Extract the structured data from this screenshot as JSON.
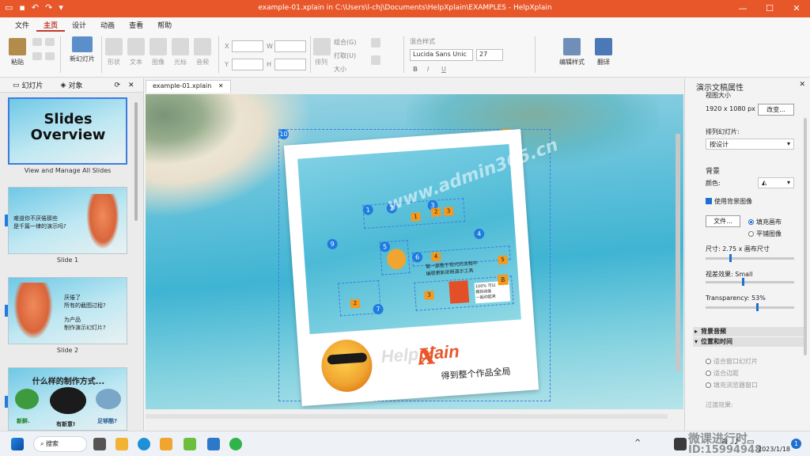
{
  "window": {
    "title": "example-01.xplain in C:\\Users\\l-chj\\Documents\\HelpXplain\\EXAMPLES - HelpXplain",
    "minimize": "—",
    "maximize": "☐",
    "close": "✕"
  },
  "menu": [
    "文件",
    "主页",
    "设计",
    "动画",
    "查看",
    "帮助"
  ],
  "ribbon": {
    "paste": "粘贴",
    "new_slide": "新幻灯片",
    "shape": "形状",
    "text": "文本",
    "image": "图像",
    "cursor": "光标",
    "audio": "音频",
    "x_label": "X",
    "y_label": "Y",
    "w_label": "W",
    "h_label": "H",
    "arrange": "排列",
    "group": "组合(G)",
    "ungroup": "打取(U)",
    "size": "大小",
    "mixed_style": "混合样式",
    "font_name": "Lucida Sans Unic",
    "font_size": "27",
    "bold": "B",
    "italic": "I",
    "underline": "U",
    "edit_style": "编辑样式",
    "translate": "翻译"
  },
  "left_panel": {
    "tab_slides": "幻灯片",
    "tab_objects": "对象",
    "slides": [
      {
        "num": "",
        "caption": "View and Manage All Slides",
        "title": "Slides Overview"
      },
      {
        "num": "1",
        "caption": "Slide 1",
        "text": "难道你不厌倦那些\n是千篇一律的演示吗?"
      },
      {
        "num": "2",
        "caption": "Slide 2",
        "text": "厌倦了\n所有的截图过程?\n\n为产品\n制作演示幻灯片?"
      },
      {
        "num": "3",
        "caption": "",
        "title": "什么样的制作方式...",
        "sub1": "新鲜.",
        "sub2": "有新意!",
        "sub3": "足够酷?"
      }
    ]
  },
  "canvas": {
    "doc_tab": "example-01.xplain",
    "watermark": "www.admin365.cn",
    "brand_help": "Help",
    "brand_x": "X",
    "brand_plain": "plain",
    "tagline": "得到整个作品全局",
    "badges": [
      "10",
      "1",
      "2",
      "3",
      "4",
      "5",
      "6",
      "7",
      "8",
      "9"
    ],
    "orange_labels": [
      "1",
      "1",
      "2",
      "3",
      "4",
      "5",
      "6",
      "2",
      "3"
    ],
    "note_1": "第一部整于现代的流程中\n编程更新说明演示工具",
    "note_2": "100% 可以\n模拟动画\n一起动起来"
  },
  "right_panel": {
    "title": "演示文稿属性",
    "view_size_label": "视图大小",
    "view_size": "1920 x 1080 px",
    "change_btn": "改变...",
    "arrange_label": "排列幻灯片:",
    "arrange_value": "按设计",
    "bg_label": "背景",
    "color_label": "颜色:",
    "use_bg_image": "使用背景图像",
    "file_btn": "文件...",
    "fill_canvas": "填充画布",
    "tile_image": "平铺图像",
    "size_label": "尺寸: 2.75 x 画布尺寸",
    "parallax_label": "视差效果:  Small",
    "transparency_label": "Transparency: 53%",
    "sec_audio": "背景音频",
    "sec_position": "位置和时间",
    "fit_window": "适合窗口幻灯片",
    "fit_margin": "适合边距",
    "fill_browser": "填充浏览器窗口",
    "transition_label": "过渡效果:"
  },
  "taskbar": {
    "search": "搜索",
    "date": "2023/1/18",
    "watermark_1": "微课进行时",
    "watermark_2": "ID:15994948",
    "notif_count": "1"
  },
  "colors": {
    "titlebar": "#e8572a",
    "accent_blue": "#1e7be0",
    "orange_box": "#f39a1e"
  }
}
